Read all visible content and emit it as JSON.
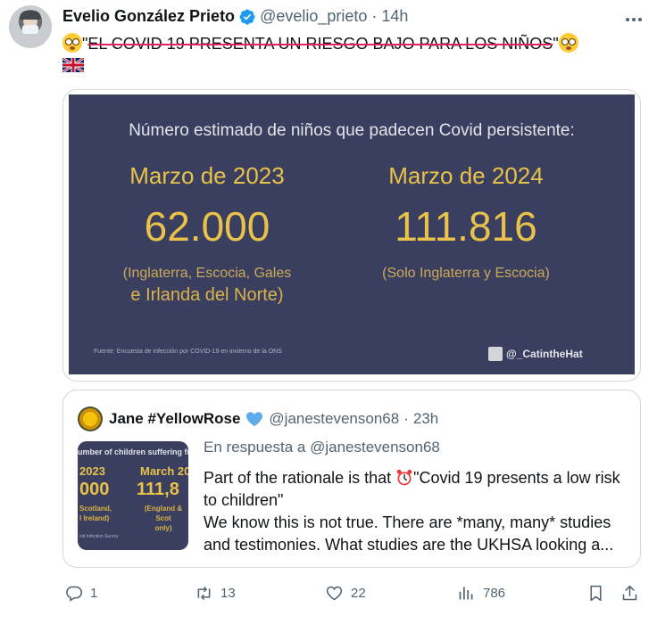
{
  "tweet": {
    "author_name": "Evelio González Prieto",
    "author_handle": "@evelio_prieto",
    "separator": "·",
    "time": "14h",
    "quote_open": "\"",
    "struck_text": "EL COVID 19 PRESENTA UN RIESGO BAJO PARA LOS NIÑOS",
    "quote_close": "\""
  },
  "media": {
    "title": "Número estimado de niños que padecen Covid persistente:",
    "left_label": "Marzo de 2023",
    "left_value": "62.000",
    "left_note_1": "(Inglaterra, Escocia, Gales",
    "left_note_2": "e Irlanda del Norte)",
    "right_label": "Marzo de 2024",
    "right_value": "111.816",
    "right_note": "(Solo Inglaterra y Escocia)",
    "source": "Fuente: Encuesta de infección por COVID-19 en invierno de la ONS",
    "credit": "@_CatintheHat"
  },
  "quote": {
    "author_name": "Jane #YellowRose",
    "author_handle": "@janestevenson68",
    "separator": "·",
    "time": "23h",
    "reply_to": "En respuesta a @janestevenson68",
    "body_1": "Part of the rationale is that ",
    "body_2": "\"Covid 19 presents a low risk to children\"",
    "body_3": "We know this is not true. There are *many, many* studies and testimonies. What studies are the UKHSA looking a...",
    "thumb": {
      "title": "umber of children suffering from Lo",
      "year_1": "2023",
      "year_2": "March 20",
      "value_1": "000",
      "value_2": "111,8",
      "sub_1a": "Scotland,",
      "sub_1b": "l Ireland)",
      "sub_2a": "(England & Scot",
      "sub_2b": "only)",
      "source": "vid Infection Survey"
    }
  },
  "actions": {
    "replies": "1",
    "retweets": "13",
    "likes": "22",
    "views": "786"
  },
  "colors": {
    "slide_bg": "#3b3f5f",
    "slide_gold": "#e8c24a",
    "strike_red": "#e0245e",
    "verified_blue": "#1d9bf0",
    "muted": "#536471"
  },
  "icons": [
    "more-icon",
    "verified-badge-icon",
    "flushed-face-emoji",
    "uk-flag-emoji",
    "blue-heart-emoji",
    "alarm-clock-emoji",
    "reply-icon",
    "retweet-icon",
    "like-icon",
    "views-icon",
    "bookmark-icon",
    "share-icon"
  ]
}
